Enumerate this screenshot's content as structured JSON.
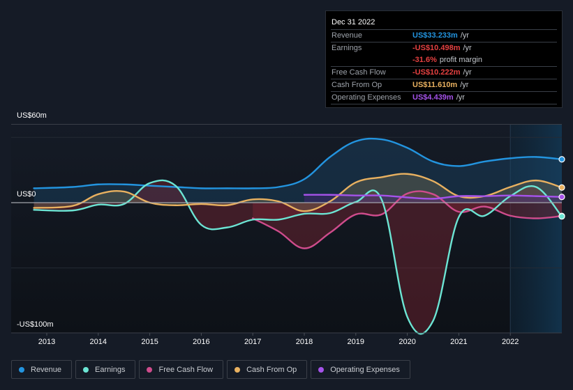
{
  "tooltip": {
    "date": "Dec 31 2022",
    "rows": [
      {
        "label": "Revenue",
        "value": "US$33.233m",
        "unit": "/yr",
        "color": "#2394df"
      },
      {
        "label": "Earnings",
        "value": "-US$10.498m",
        "unit": "/yr",
        "color": "#e64141"
      },
      {
        "label": "",
        "value": "-31.6%",
        "unit": "profit margin",
        "color": "#e64141"
      },
      {
        "label": "Free Cash Flow",
        "value": "-US$10.222m",
        "unit": "/yr",
        "color": "#e64141"
      },
      {
        "label": "Cash From Op",
        "value": "US$11.610m",
        "unit": "/yr",
        "color": "#e9b160"
      },
      {
        "label": "Operating Expenses",
        "value": "US$4.439m",
        "unit": "/yr",
        "color": "#a553ea"
      }
    ]
  },
  "legend": [
    {
      "label": "Revenue",
      "color": "#2394df"
    },
    {
      "label": "Earnings",
      "color": "#6ce5d4"
    },
    {
      "label": "Free Cash Flow",
      "color": "#cf4c8c"
    },
    {
      "label": "Cash From Op",
      "color": "#e9b160"
    },
    {
      "label": "Operating Expenses",
      "color": "#a553ea"
    }
  ],
  "chart_data": {
    "type": "line",
    "title": "",
    "xlabel": "",
    "ylabel": "",
    "ylim": [
      -100,
      60
    ],
    "xlim": [
      2012.75,
      2023.0
    ],
    "y_ticks": [
      {
        "value": 60,
        "label": "US$60m"
      },
      {
        "value": 0,
        "label": "US$0"
      },
      {
        "value": -100,
        "label": "-US$100m"
      }
    ],
    "gridlines": [
      60,
      50,
      0,
      -50
    ],
    "x_ticks": [
      {
        "value": 2013,
        "label": "2013"
      },
      {
        "value": 2014,
        "label": "2014"
      },
      {
        "value": 2015,
        "label": "2015"
      },
      {
        "value": 2016,
        "label": "2016"
      },
      {
        "value": 2017,
        "label": "2017"
      },
      {
        "value": 2018,
        "label": "2018"
      },
      {
        "value": 2019,
        "label": "2019"
      },
      {
        "value": 2020,
        "label": "2020"
      },
      {
        "value": 2021,
        "label": "2021"
      },
      {
        "value": 2022,
        "label": "2022"
      }
    ],
    "highlight_from": 2022.0,
    "series": [
      {
        "name": "Revenue",
        "color": "#2394df",
        "x": [
          2012.75,
          2013.5,
          2014.0,
          2014.5,
          2015.0,
          2015.5,
          2016.0,
          2016.5,
          2017.0,
          2017.5,
          2018.0,
          2018.5,
          2019.0,
          2019.5,
          2020.0,
          2020.5,
          2021.0,
          2021.5,
          2022.0,
          2022.5,
          2023.0
        ],
        "values": [
          11,
          12,
          14,
          14,
          13,
          12,
          11,
          11,
          11,
          12,
          18,
          35,
          47,
          48.5,
          42,
          31.5,
          28,
          31.5,
          34,
          35,
          33.2
        ]
      },
      {
        "name": "Earnings",
        "color": "#6ce5d4",
        "x": [
          2012.75,
          2013.5,
          2014.0,
          2014.5,
          2015.0,
          2015.5,
          2016.0,
          2016.5,
          2017.0,
          2017.5,
          2018.0,
          2018.5,
          2019.0,
          2019.5,
          2020.0,
          2020.5,
          2021.0,
          2021.5,
          2022.0,
          2022.5,
          2023.0
        ],
        "values": [
          -5.5,
          -6,
          -1.5,
          -1,
          15,
          13,
          -17,
          -19,
          -13,
          -13,
          -8.5,
          -8,
          0.5,
          2.5,
          -87.5,
          -90.5,
          -11,
          -10,
          5,
          12,
          -10.5
        ]
      },
      {
        "name": "Free Cash Flow",
        "color": "#cf4c8c",
        "x": [
          2017.0,
          2017.5,
          2018.0,
          2018.5,
          2019.0,
          2019.5,
          2020.0,
          2020.5,
          2021.0,
          2021.5,
          2022.0,
          2022.5,
          2023.0
        ],
        "values": [
          -12,
          -22,
          -35,
          -23,
          -9,
          -9,
          7,
          6.5,
          -7,
          -3,
          -10,
          -12,
          -10.2
        ]
      },
      {
        "name": "Cash From Op",
        "color": "#e9b160",
        "x": [
          2012.75,
          2013.5,
          2014.0,
          2014.5,
          2015.0,
          2015.5,
          2016.0,
          2016.5,
          2017.0,
          2017.5,
          2018.0,
          2018.5,
          2019.0,
          2019.5,
          2020.0,
          2020.5,
          2021.0,
          2021.5,
          2022.0,
          2022.5,
          2023.0
        ],
        "values": [
          -4,
          -2.5,
          6.5,
          8.5,
          0,
          -2,
          -1,
          -2,
          2.5,
          1,
          -6.5,
          1,
          15.5,
          19.5,
          22,
          16.5,
          5,
          5,
          12,
          17,
          11.6
        ]
      },
      {
        "name": "Operating Expenses",
        "color": "#a553ea",
        "x": [
          2018.0,
          2018.5,
          2019.0,
          2019.5,
          2020.0,
          2020.5,
          2021.0,
          2021.5,
          2022.0,
          2022.5,
          2023.0
        ],
        "values": [
          6,
          6,
          5.5,
          5.5,
          4,
          3,
          5,
          5,
          5.5,
          5,
          4.4
        ]
      }
    ]
  }
}
